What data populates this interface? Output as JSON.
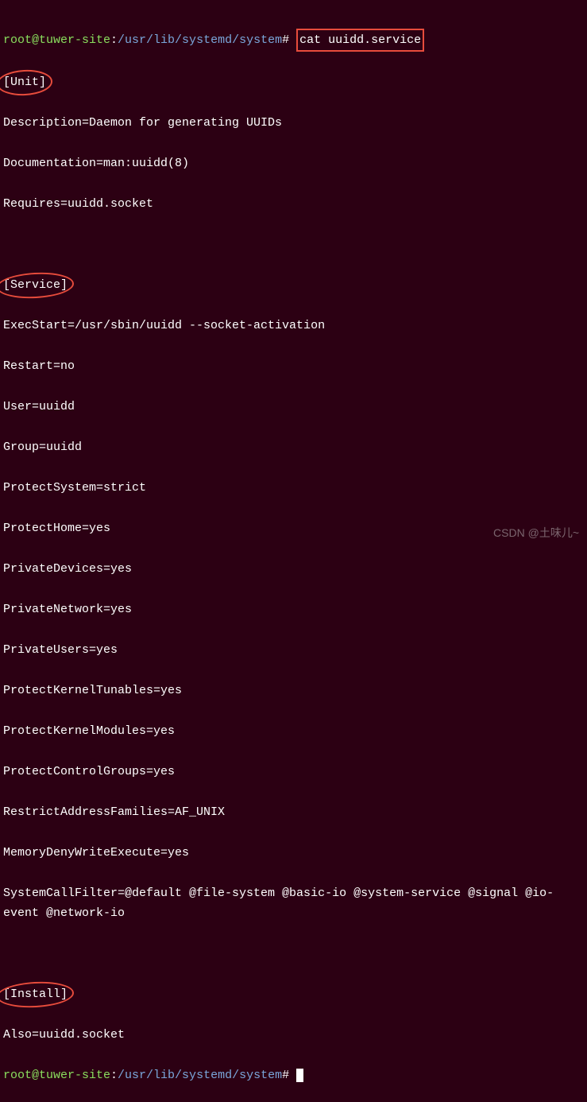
{
  "prompt1": {
    "user": "root@tuwer-site",
    "path": "/usr/lib/systemd/system",
    "symbol": "#",
    "command": "cat uuidd.service"
  },
  "sections": {
    "unit": {
      "header": "[Unit]",
      "lines": [
        "Description=Daemon for generating UUIDs",
        "Documentation=man:uuidd(8)",
        "Requires=uuidd.socket"
      ]
    },
    "service": {
      "header": "[Service]",
      "lines": [
        "ExecStart=/usr/sbin/uuidd --socket-activation",
        "Restart=no",
        "User=uuidd",
        "Group=uuidd",
        "ProtectSystem=strict",
        "ProtectHome=yes",
        "PrivateDevices=yes",
        "PrivateNetwork=yes",
        "PrivateUsers=yes",
        "ProtectKernelTunables=yes",
        "ProtectKernelModules=yes",
        "ProtectControlGroups=yes",
        "RestrictAddressFamilies=AF_UNIX",
        "MemoryDenyWriteExecute=yes",
        "SystemCallFilter=@default @file-system @basic-io @system-service @signal @io-event @network-io"
      ]
    },
    "install": {
      "header": "[Install]",
      "lines": [
        "Also=uuidd.socket"
      ]
    }
  },
  "prompt2": {
    "user": "root@tuwer-site",
    "path": "/usr/lib/systemd/system",
    "symbol": "#"
  },
  "watermark": "CSDN @土味儿~"
}
